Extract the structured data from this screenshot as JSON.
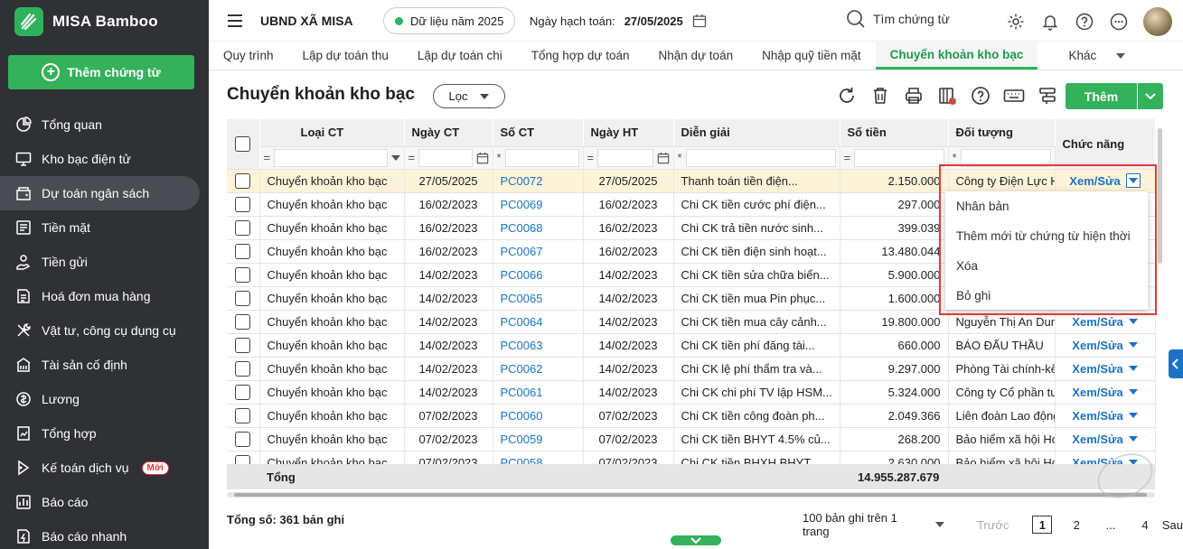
{
  "app": {
    "name": "MISA Bamboo",
    "add_label": "Thêm chứng từ"
  },
  "sidebar": {
    "items": [
      {
        "label": "Tổng quan",
        "icon": "pie-chart-icon"
      },
      {
        "label": "Kho bạc điện tử",
        "icon": "monitor-icon"
      },
      {
        "label": "Dự toán ngân sách",
        "icon": "budget-icon"
      },
      {
        "label": "Tiền mặt",
        "icon": "cash-icon"
      },
      {
        "label": "Tiền gửi",
        "icon": "deposit-icon"
      },
      {
        "label": "Hoá đơn mua hàng",
        "icon": "invoice-icon"
      },
      {
        "label": "Vật tư, công cụ dụng cụ",
        "icon": "tools-icon"
      },
      {
        "label": "Tài sản cố định",
        "icon": "building-icon"
      },
      {
        "label": "Lương",
        "icon": "salary-icon"
      },
      {
        "label": "Tổng hợp",
        "icon": "summary-icon"
      },
      {
        "label": "Kế toán dịch vụ",
        "icon": "service-icon",
        "badge": "Mới"
      },
      {
        "label": "Báo cáo",
        "icon": "report-icon"
      },
      {
        "label": "Báo cáo nhanh",
        "icon": "quick-report-icon"
      }
    ]
  },
  "header": {
    "org": "UBND XÃ MISA",
    "year": "Dữ liệu năm 2025",
    "date_label": "Ngày hạch toán:",
    "date_value": "27/05/2025",
    "search": "Tìm chứng từ"
  },
  "tabs": [
    "Quy trình",
    "Lập dự toán thu",
    "Lập dự toán chi",
    "Tổng hợp dự toán",
    "Nhận dự toán",
    "Nhập quỹ tiền mặt",
    "Chuyển khoản kho bạc",
    "Khác"
  ],
  "page": {
    "title": "Chuyển khoản kho bạc",
    "filter": "Lọc",
    "add": "Thêm"
  },
  "table": {
    "headers": {
      "type": "Loại CT",
      "date": "Ngày CT",
      "no": "Số CT",
      "post": "Ngày HT",
      "desc": "Diễn giải",
      "amount": "Số tiền",
      "party": "Đối tượng",
      "action": "Chức năng"
    },
    "filter_ops": {
      "type": "=",
      "date": "=",
      "no": "*",
      "post": "=",
      "desc": "*",
      "amount": "=",
      "party": "*"
    },
    "rows": [
      [
        "Chuyển khoản kho bạc",
        "27/05/2025",
        "PC0072",
        "27/05/2025",
        "Thanh toán tiền điện...",
        "2.150.000",
        "Công ty Điện Lực Hoài Đức"
      ],
      [
        "Chuyển khoản kho bạc",
        "16/02/2023",
        "PC0069",
        "16/02/2023",
        "Chi CK tiền cước phí điện...",
        "297.000",
        ""
      ],
      [
        "Chuyển khoản kho bạc",
        "16/02/2023",
        "PC0068",
        "16/02/2023",
        "Chi CK trả tiền nước sinh...",
        "399.039",
        ""
      ],
      [
        "Chuyển khoản kho bạc",
        "16/02/2023",
        "PC0067",
        "16/02/2023",
        "Chi CK tiền điện sinh hoạt...",
        "13.480.044",
        ""
      ],
      [
        "Chuyển khoản kho bạc",
        "14/02/2023",
        "PC0066",
        "14/02/2023",
        "Chi CK tiền sửa chữa biển...",
        "5.900.000",
        ""
      ],
      [
        "Chuyển khoản kho bạc",
        "14/02/2023",
        "PC0065",
        "14/02/2023",
        "Chi CK tiền mua Pin phục...",
        "1.600.000",
        ""
      ],
      [
        "Chuyển khoản kho bạc",
        "14/02/2023",
        "PC0064",
        "14/02/2023",
        "Chi CK tiền mua cây cảnh...",
        "19.800.000",
        "Nguyễn Thị An Dung"
      ],
      [
        "Chuyển khoản kho bạc",
        "14/02/2023",
        "PC0063",
        "14/02/2023",
        "Chi CK tiền phí đăng tài...",
        "660.000",
        "BÁO ĐẤU THẦU"
      ],
      [
        "Chuyển khoản kho bạc",
        "14/02/2023",
        "PC0062",
        "14/02/2023",
        "Chi CK lệ phí thẩm tra và...",
        "9.297.000",
        "Phòng Tài chính-kế hoạch"
      ],
      [
        "Chuyển khoản kho bạc",
        "14/02/2023",
        "PC0061",
        "14/02/2023",
        "Chi CK chi phí TV lập HSM...",
        "5.324.000",
        "Công ty Cổ phần tư vấn"
      ],
      [
        "Chuyển khoản kho bạc",
        "07/02/2023",
        "PC0060",
        "07/02/2023",
        "Chi CK tiền công đoàn ph...",
        "2.049.366",
        "Liên đoàn Lao động"
      ],
      [
        "Chuyển khoản kho bạc",
        "07/02/2023",
        "PC0059",
        "07/02/2023",
        "Chi CK tiền BHYT 4.5% củ...",
        "268.200",
        "Bảo hiểm xã hội Hoài Đức"
      ],
      [
        "Chuyển khoản kho bạc",
        "07/02/2023",
        "PC0058",
        "07/02/2023",
        "Chi CK tiền BHXH BHYT...",
        "2.630.000",
        "Bảo hiểm xã hội Hoài Đức"
      ]
    ],
    "action_label": "Xem/Sửa",
    "total_label": "Tổng",
    "total_value": "14.955.287.679"
  },
  "dropdown": [
    "Nhân bản",
    "Thêm mới từ chứng từ hiện thời",
    "Xóa",
    "Bỏ ghi"
  ],
  "footer": {
    "count_label": "Tổng số:",
    "count_value": "361",
    "count_unit": "bản ghi",
    "per_page": "100 bản ghi trên 1 trang",
    "prev": "Trước",
    "pages": [
      "1",
      "2",
      "...",
      "4"
    ],
    "next": "Sau"
  },
  "colors": {
    "accent": "#33b25b",
    "link": "#1a73c6",
    "sidebar": "#2f3135",
    "highlight": "#e53935"
  }
}
